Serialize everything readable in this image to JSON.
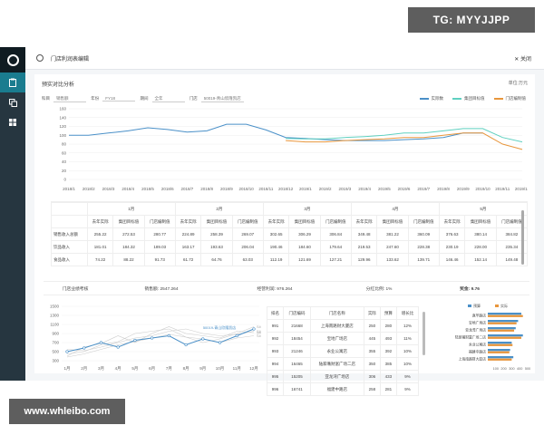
{
  "watermarks": {
    "top": "TG: MYYJJPP",
    "bottom": "www.whleibo.com"
  },
  "sidebar": {
    "items": [
      "logo",
      "clipboard-icon",
      "copy-icon",
      "grid-icon"
    ]
  },
  "header": {
    "title": "门店利润表编辑",
    "close_label": "关闭"
  },
  "panel": {
    "title": "预实对比分析",
    "unit": "单位:万元"
  },
  "filters": [
    {
      "label": "科目",
      "value": "销售额"
    },
    {
      "label": "年份",
      "value": "FY18"
    },
    {
      "label": "期间",
      "value": "全年"
    },
    {
      "label": "门店",
      "value": "50019-青山欣隆凯店"
    }
  ],
  "legend": [
    {
      "label": "实际数",
      "color": "#4a90c8"
    },
    {
      "label": "集团目标值",
      "color": "#5fd0c0"
    },
    {
      "label": "门店编制值",
      "color": "#e8963c"
    }
  ],
  "chart_data": [
    {
      "type": "line",
      "x": [
        "2018/1",
        "2018/2",
        "2018/3",
        "2018/4",
        "2018/5",
        "2018/6",
        "2018/7",
        "2018/8",
        "2018/9",
        "2018/10",
        "2018/11",
        "2018/12",
        "2019/1",
        "2019/2",
        "2019/3",
        "2019/4",
        "2019/5",
        "2019/6",
        "2019/7",
        "2019/8",
        "2019/9",
        "2019/10",
        "2019/11",
        "2019/12"
      ],
      "yticks": [
        0,
        20,
        40,
        60,
        80,
        100,
        120,
        140,
        160
      ],
      "ylim": [
        0,
        160
      ],
      "series": [
        {
          "name": "实际数",
          "values": [
            100,
            100,
            105,
            110,
            117,
            113,
            107,
            110,
            125,
            125,
            112,
            95,
            93,
            90,
            88,
            88,
            88,
            90,
            92,
            95,
            105,
            105,
            null,
            null
          ]
        },
        {
          "name": "集团目标值",
          "values": [
            null,
            null,
            null,
            null,
            null,
            null,
            null,
            null,
            null,
            null,
            null,
            93,
            92,
            92,
            95,
            97,
            100,
            105,
            105,
            110,
            115,
            115,
            95,
            85
          ]
        },
        {
          "name": "门店编制值",
          "values": [
            null,
            null,
            null,
            null,
            null,
            null,
            null,
            null,
            null,
            null,
            null,
            88,
            85,
            85,
            88,
            90,
            92,
            95,
            95,
            100,
            105,
            105,
            80,
            68
          ]
        }
      ]
    },
    {
      "type": "line",
      "x": [
        "1月",
        "2月",
        "3月",
        "4月",
        "5月",
        "6月",
        "7月",
        "8月",
        "9月",
        "10月",
        "11月",
        "12月"
      ],
      "yticks": [
        300,
        500,
        700,
        900,
        1100,
        1300,
        1500
      ],
      "ylim": [
        300,
        1500
      ],
      "series": [
        {
          "name": "50019-青山欣隆凯店",
          "values": [
            500,
            580,
            700,
            600,
            750,
            800,
            850,
            650,
            780,
            700,
            850,
            1000
          ]
        },
        {
          "name": "S402",
          "values": [
            450,
            500,
            650,
            720,
            900,
            950,
            1000,
            820,
            700,
            780,
            900,
            1050
          ]
        },
        {
          "name": "S403",
          "values": [
            400,
            600,
            680,
            850,
            700,
            900,
            1050,
            900,
            850,
            800,
            950,
            920
          ]
        },
        {
          "name": "S404",
          "values": [
            550,
            520,
            600,
            700,
            800,
            850,
            950,
            1000,
            900,
            850,
            880,
            950
          ]
        },
        {
          "name": "S405",
          "values": [
            380,
            450,
            550,
            650,
            720,
            800,
            880,
            820,
            780,
            700,
            800,
            850
          ]
        }
      ]
    },
    {
      "type": "bar",
      "categories": [
        "真华路店",
        "宝地广场店",
        "亚龙湾广场店",
        "陆家嘴财富广场二店",
        "永业公寓店",
        "福建中路店",
        "上海南路财大厦店"
      ],
      "xticks": [
        100,
        200,
        300,
        400,
        500
      ],
      "xlim": [
        0,
        500
      ],
      "series": [
        {
          "name": "预算",
          "values": [
            420,
            380,
            350,
            440,
            300,
            280,
            320
          ]
        },
        {
          "name": "实际",
          "values": [
            440,
            360,
            330,
            420,
            310,
            270,
            300
          ]
        }
      ]
    }
  ],
  "table1": {
    "months": [
      "1月",
      "2月",
      "3月",
      "4月",
      "5月"
    ],
    "subcols": [
      "去年实际",
      "集团目标值",
      "门店编制值"
    ],
    "rows": [
      {
        "label": "销售收入总额",
        "values": [
          "255.22",
          "272.53",
          "280.77",
          "224.89",
          "258.39",
          "269.07",
          "302.65",
          "306.29",
          "306.84",
          "349.48",
          "381.22",
          "360.09",
          "376.63",
          "380.14",
          "384.82"
        ]
      },
      {
        "label": "饮品收入",
        "values": [
          "181.01",
          "184.32",
          "189.03",
          "163.17",
          "193.63",
          "206.04",
          "190.46",
          "184.60",
          "179.64",
          "219.53",
          "247.60",
          "228.38",
          "230.19",
          "228.00",
          "235.34"
        ]
      },
      {
        "label": "食品收入",
        "values": [
          "74.22",
          "88.22",
          "91.73",
          "61.72",
          "64.76",
          "63.03",
          "112.19",
          "121.69",
          "127.21",
          "129.96",
          "133.62",
          "139.71",
          "146.46",
          "152.14",
          "149.48"
        ]
      }
    ]
  },
  "kpis": {
    "store_score_label": "门店业绩考核",
    "sales": "销售额: 2547.264",
    "profit": "经营利润: 976.264",
    "ratio": "分红比例: 1%",
    "bonus": "奖金: 9.76"
  },
  "store_table": {
    "headers": [
      "排名",
      "门店编码",
      "门店名称",
      "实际",
      "预算",
      "增长比"
    ],
    "rows": [
      [
        "991",
        "21668",
        "上海南路财大厦店",
        "250",
        "280",
        "12%"
      ],
      [
        "992",
        "18454",
        "宝地广场店",
        "445",
        "493",
        "11%"
      ],
      [
        "993",
        "21246",
        "永业公寓店",
        "355",
        "392",
        "10%"
      ],
      [
        "994",
        "16465",
        "陆家嘴财富广场二店",
        "350",
        "385",
        "10%"
      ],
      [
        "995",
        "15205",
        "亚龙湾广场店",
        "306",
        "433",
        "9%"
      ],
      [
        "996",
        "16741",
        "福建中路店",
        "258",
        "281",
        "9%"
      ]
    ]
  }
}
